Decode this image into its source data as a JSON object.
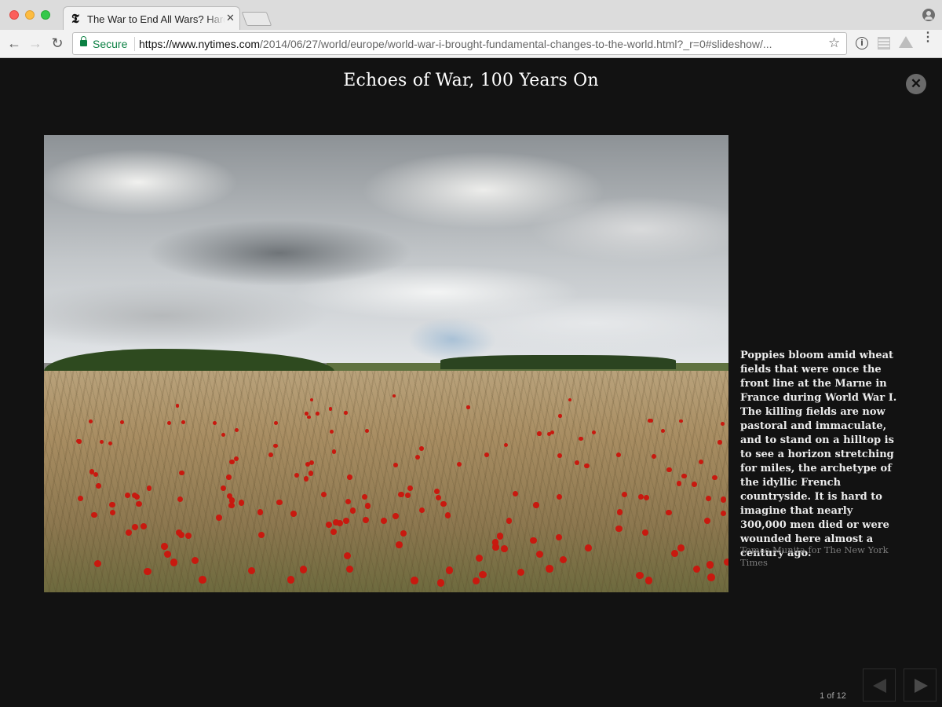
{
  "browser": {
    "tab": {
      "title": "The War to End All Wars? Hard",
      "close_glyph": "✕",
      "favicon_glyph": "𝕿"
    },
    "address_bar": {
      "secure_label": "Secure",
      "url_host": "https://www.nytimes.com",
      "url_path": "/2014/06/27/world/europe/world-war-i-brought-fundamental-changes-to-the-world.html?_r=0#slideshow/..."
    },
    "icons": {
      "back": "←",
      "forward": "→",
      "reload": "↻",
      "bookmark": "☆",
      "info": "i",
      "menu": "⋮"
    }
  },
  "slideshow": {
    "title": "Echoes of War, 100 Years On",
    "close_glyph": "✕",
    "caption": "Poppies bloom amid wheat fields that were once the front line at the Marne in France during World War I. The killing fields are now pastoral and immaculate, and to stand on a hilltop is to see a horizon stretching for miles, the archetype of the idyllic French countryside. It is hard to imagine that nearly 300,000 men died or were wounded here almost a century ago.",
    "credit": "Tomas Munita for The New York Times",
    "counter": "1 of 12"
  }
}
